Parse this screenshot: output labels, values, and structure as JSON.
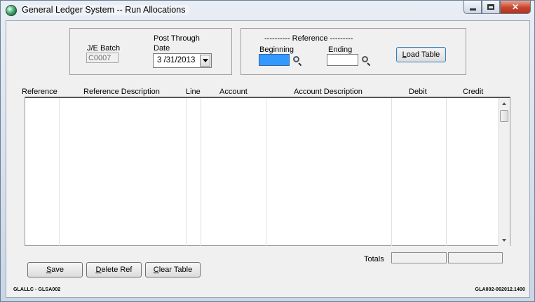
{
  "window": {
    "title": "General Ledger System -- Run Allocations"
  },
  "batch": {
    "label": "J/E Batch",
    "value": "C0007"
  },
  "post_through": {
    "label_line1": "Post Through",
    "label_line2": "Date",
    "value": "3 /31/2013"
  },
  "reference": {
    "group_title": "---------- Reference ---------",
    "beginning_label": "Beginning",
    "ending_label": "Ending",
    "beginning_value": "",
    "ending_value": "",
    "load_button": {
      "underline": "L",
      "rest": "oad Table"
    }
  },
  "grid": {
    "columns": [
      "Reference",
      "Reference Description",
      "Line",
      "Account",
      "Account Description",
      "Debit",
      "Credit"
    ],
    "rows": []
  },
  "totals": {
    "label": "Totals",
    "debit": "",
    "credit": ""
  },
  "buttons": {
    "save": {
      "underline": "S",
      "rest": "ave"
    },
    "delete_ref": {
      "underline": "D",
      "rest": "elete Ref"
    },
    "clear_table": {
      "underline": "C",
      "rest": "lear Table"
    }
  },
  "footer": {
    "left": "GLALLC - GLSA002",
    "right": "GLA002-062012.1400"
  },
  "colors": {
    "accent_selected_field": "#3399ff",
    "close_button": "#c8432b"
  },
  "icons": [
    "app-globe-icon",
    "minimize-icon",
    "maximize-icon",
    "close-icon",
    "magnifier-icon",
    "chevron-down-icon"
  ]
}
